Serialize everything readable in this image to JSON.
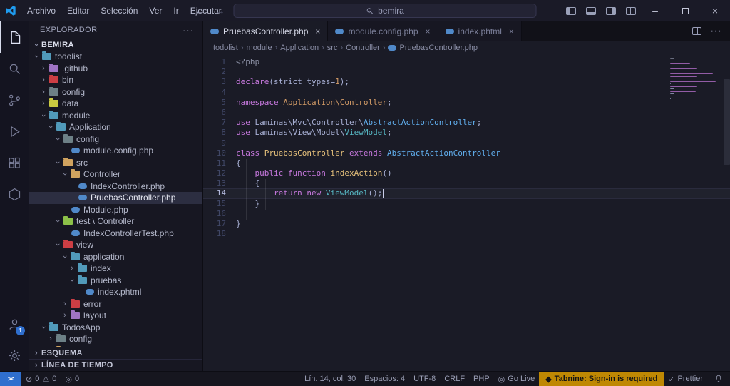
{
  "titlebar": {
    "menus": [
      "Archivo",
      "Editar",
      "Selección",
      "Ver",
      "Ir",
      "Ejecutar"
    ],
    "menu_more": "···",
    "search_value": "bemira"
  },
  "activity_bar": {
    "accounts_badge": "1"
  },
  "sidebar": {
    "header": "EXPLORADOR",
    "header_more": "···",
    "root": "BEMIRA",
    "sections": [
      "ESQUEMA",
      "LÍNEA DE TIEMPO"
    ],
    "tree": [
      {
        "label": "todolist",
        "level": 0,
        "type": "folder",
        "open": true,
        "color": "#519aba"
      },
      {
        "label": ".github",
        "level": 1,
        "type": "folder",
        "open": false,
        "color": "#a074c4"
      },
      {
        "label": "bin",
        "level": 1,
        "type": "folder",
        "open": false,
        "color": "#cc3e44"
      },
      {
        "label": "config",
        "level": 1,
        "type": "folder",
        "open": false,
        "color": "#6d8086"
      },
      {
        "label": "data",
        "level": 1,
        "type": "folder",
        "open": false,
        "color": "#cbcb41"
      },
      {
        "label": "module",
        "level": 1,
        "type": "folder",
        "open": true,
        "color": "#519aba"
      },
      {
        "label": "Application",
        "level": 2,
        "type": "folder",
        "open": true,
        "color": "#519aba"
      },
      {
        "label": "config",
        "level": 3,
        "type": "folder",
        "open": true,
        "color": "#6d8086"
      },
      {
        "label": "module.config.php",
        "level": 4,
        "type": "file",
        "icon": "php"
      },
      {
        "label": "src",
        "level": 3,
        "type": "folder",
        "open": true,
        "color": "#d0a35f"
      },
      {
        "label": "Controller",
        "level": 4,
        "type": "folder",
        "open": true,
        "color": "#d0a35f"
      },
      {
        "label": "IndexController.php",
        "level": 5,
        "type": "file",
        "icon": "php"
      },
      {
        "label": "PruebasController.php",
        "level": 5,
        "type": "file",
        "icon": "php",
        "selected": true
      },
      {
        "label": "Module.php",
        "level": 4,
        "type": "file",
        "icon": "php"
      },
      {
        "label": "test \\ Controller",
        "level": 3,
        "type": "folder",
        "open": true,
        "color": "#8dc149"
      },
      {
        "label": "IndexControllerTest.php",
        "level": 4,
        "type": "file",
        "icon": "php"
      },
      {
        "label": "view",
        "level": 3,
        "type": "folder",
        "open": true,
        "color": "#cc3e44"
      },
      {
        "label": "application",
        "level": 4,
        "type": "folder",
        "open": true,
        "color": "#519aba"
      },
      {
        "label": "index",
        "level": 5,
        "type": "folder",
        "open": false,
        "color": "#519aba"
      },
      {
        "label": "pruebas",
        "level": 5,
        "type": "folder",
        "open": true,
        "color": "#519aba"
      },
      {
        "label": "index.phtml",
        "level": 6,
        "type": "file",
        "icon": "php"
      },
      {
        "label": "error",
        "level": 4,
        "type": "folder",
        "open": false,
        "color": "#cc3e44"
      },
      {
        "label": "layout",
        "level": 4,
        "type": "folder",
        "open": false,
        "color": "#a074c4"
      },
      {
        "label": "TodosApp",
        "level": 1,
        "type": "folder",
        "open": true,
        "color": "#519aba"
      },
      {
        "label": "config",
        "level": 2,
        "type": "folder",
        "open": false,
        "color": "#6d8086"
      },
      {
        "label": "src \\ Controller",
        "level": 2,
        "type": "folder",
        "open": false,
        "color": "#d0a35f"
      }
    ]
  },
  "tabs": [
    {
      "label": "PruebasController.php",
      "active": true
    },
    {
      "label": "module.config.php",
      "active": false
    },
    {
      "label": "index.phtml",
      "active": false
    }
  ],
  "breadcrumb": [
    "todolist",
    "module",
    "Application",
    "src",
    "Controller",
    "PruebasController.php"
  ],
  "code": {
    "lines": [
      {
        "n": 1,
        "t": [
          [
            "cmt",
            "<?php"
          ]
        ]
      },
      {
        "n": 2,
        "t": []
      },
      {
        "n": 3,
        "t": [
          [
            "kw",
            "declare"
          ],
          [
            "txt",
            "(strict_types="
          ],
          [
            "num",
            "1"
          ],
          [
            "txt",
            ");"
          ]
        ]
      },
      {
        "n": 4,
        "t": []
      },
      {
        "n": 5,
        "t": [
          [
            "kw",
            "namespace"
          ],
          [
            "txt",
            " "
          ],
          [
            "ns",
            "Application\\Controller"
          ],
          [
            "txt",
            ";"
          ]
        ]
      },
      {
        "n": 6,
        "t": []
      },
      {
        "n": 7,
        "t": [
          [
            "kw",
            "use"
          ],
          [
            "txt",
            " Laminas\\Mvc\\Controller\\"
          ],
          [
            "type",
            "AbstractActionController"
          ],
          [
            "txt",
            ";"
          ]
        ]
      },
      {
        "n": 8,
        "t": [
          [
            "kw",
            "use"
          ],
          [
            "txt",
            " Laminas\\View\\Model\\"
          ],
          [
            "teal",
            "ViewModel"
          ],
          [
            "txt",
            ";"
          ]
        ]
      },
      {
        "n": 9,
        "t": []
      },
      {
        "n": 10,
        "t": [
          [
            "kw",
            "class"
          ],
          [
            "txt",
            " "
          ],
          [
            "cls",
            "PruebasController"
          ],
          [
            "txt",
            " "
          ],
          [
            "kw",
            "extends"
          ],
          [
            "txt",
            " "
          ],
          [
            "type",
            "AbstractActionController"
          ]
        ]
      },
      {
        "n": 11,
        "t": [
          [
            "txt",
            "{"
          ]
        ]
      },
      {
        "n": 12,
        "t": [
          [
            "txt",
            "    "
          ],
          [
            "kw",
            "public"
          ],
          [
            "txt",
            " "
          ],
          [
            "kw",
            "function"
          ],
          [
            "txt",
            " "
          ],
          [
            "cls",
            "indexAction"
          ],
          [
            "txt",
            "()"
          ]
        ]
      },
      {
        "n": 13,
        "t": [
          [
            "txt",
            "    {"
          ]
        ]
      },
      {
        "n": 14,
        "t": [
          [
            "txt",
            "        "
          ],
          [
            "kw",
            "return"
          ],
          [
            "txt",
            " "
          ],
          [
            "kw",
            "new"
          ],
          [
            "txt",
            " "
          ],
          [
            "teal",
            "ViewModel"
          ],
          [
            "txt",
            "();"
          ]
        ],
        "current": true
      },
      {
        "n": 15,
        "t": [
          [
            "txt",
            "    }"
          ]
        ]
      },
      {
        "n": 16,
        "t": []
      },
      {
        "n": 17,
        "t": [
          [
            "txt",
            "}"
          ]
        ]
      },
      {
        "n": 18,
        "t": []
      }
    ]
  },
  "statusbar": {
    "errors": "0",
    "warnings": "0",
    "ports": "0",
    "items": [
      {
        "name": "cursor-position",
        "label": "Lín. 14, col. 30"
      },
      {
        "name": "indentation",
        "label": "Espacios: 4"
      },
      {
        "name": "encoding",
        "label": "UTF-8"
      },
      {
        "name": "eol",
        "label": "CRLF"
      },
      {
        "name": "language-php",
        "label": "PHP"
      },
      {
        "name": "go-live",
        "label": "Go Live",
        "icon": "broadcast"
      },
      {
        "name": "tabnine",
        "label": "Tabnine: Sign-in is required",
        "icon": "tabnine",
        "warning": true
      },
      {
        "name": "prettier",
        "label": "Prettier",
        "icon": "check"
      }
    ]
  },
  "colors": {
    "accent": "#2f6fce",
    "warning_badge": "#bf8803",
    "php_icon": "#5089c9",
    "token_colors": {
      "kw": "#c678dd",
      "ns": "#d19a66",
      "cls": "#e5c07b",
      "type": "#61afef",
      "teal": "#56b6c2",
      "txt": "#a9b1d6",
      "cmt": "#8a8fa3",
      "num": "#d19a66"
    }
  }
}
